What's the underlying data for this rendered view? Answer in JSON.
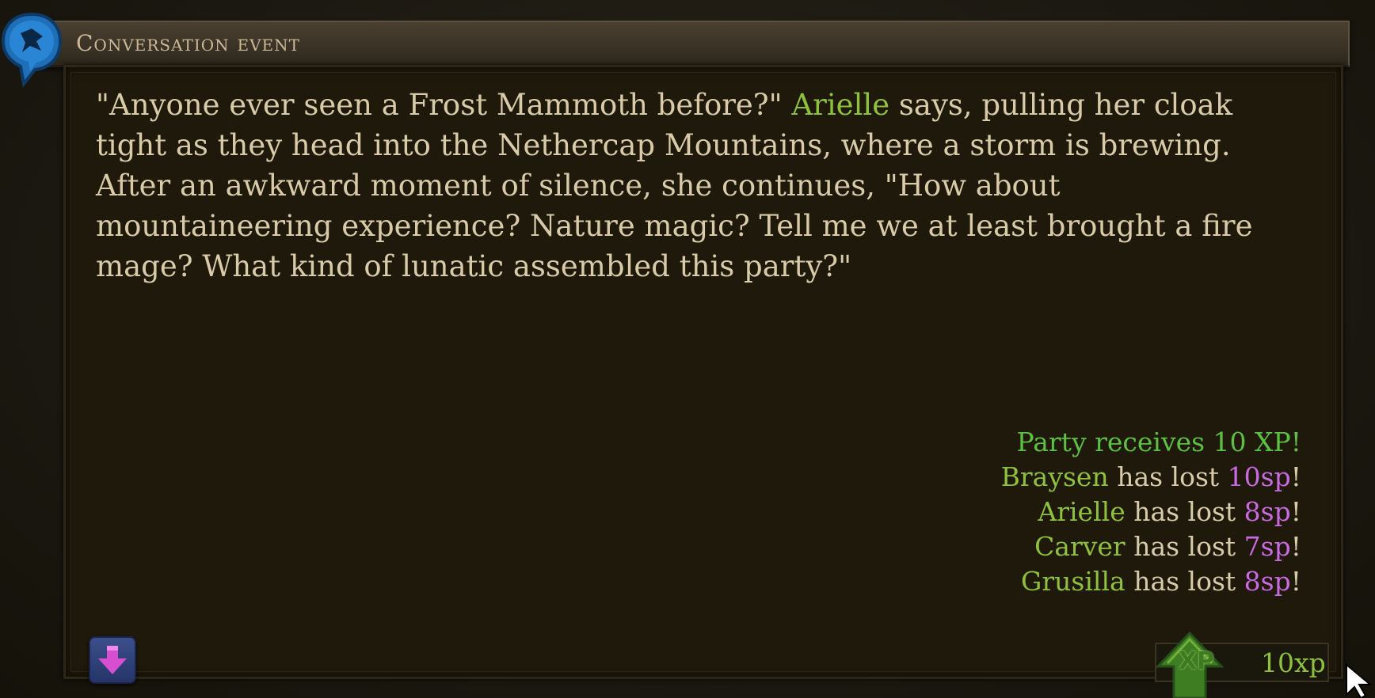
{
  "header": {
    "title": "Conversation event",
    "icon": "speech-bubble-icon"
  },
  "narrative": {
    "before_speaker": "\"Anyone ever seen a Frost Mammoth before?\" ",
    "speaker": "Arielle",
    "after_speaker": " says, pulling her cloak tight as they head into the Nethercap Mountains, where a storm is brewing. After an awkward moment of silence, she continues, \"How about mountaineering experience? Nature magic? Tell me we at least brought a fire mage? What kind of lunatic assembled this party?\""
  },
  "results": {
    "xp_line": "Party receives 10 XP!",
    "losses": [
      {
        "name": "Braysen",
        "text": " has lost ",
        "amount": "10sp",
        "end": "!"
      },
      {
        "name": "Arielle",
        "text": " has lost ",
        "amount": "8sp",
        "end": "!"
      },
      {
        "name": "Carver",
        "text": " has lost ",
        "amount": "7sp",
        "end": "!"
      },
      {
        "name": "Grusilla",
        "text": " has lost ",
        "amount": "8sp",
        "end": "!"
      }
    ]
  },
  "xp_badge": {
    "label": "XP",
    "value": "10xp",
    "icon": "xp-arrow-icon"
  },
  "scroll_button": {
    "icon": "arrow-down-icon"
  },
  "colors": {
    "speaker_name": "#8fc23c",
    "xp_text": "#5ec040",
    "silver_amount": "#c86ae0",
    "body_text": "#d9cba8",
    "header_text": "#cdb896"
  }
}
